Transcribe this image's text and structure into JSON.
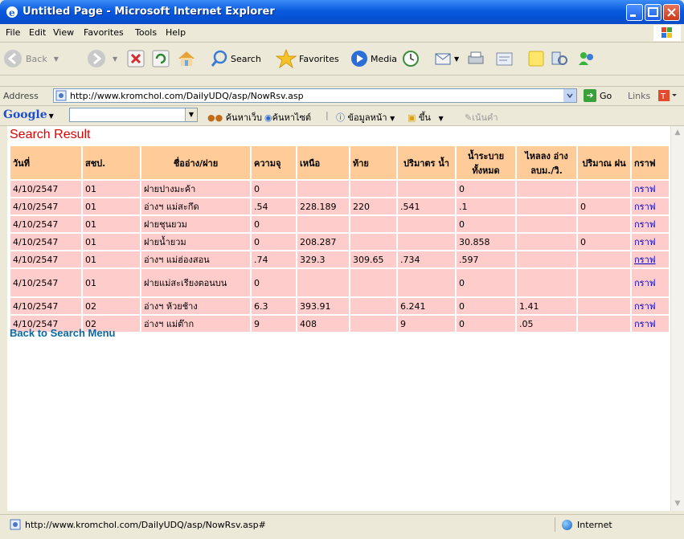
{
  "window": {
    "title": "Untitled Page - Microsoft Internet Explorer"
  },
  "menu": [
    "File",
    "Edit",
    "View",
    "Favorites",
    "Tools",
    "Help"
  ],
  "toolbar": {
    "back": "Back",
    "search": "Search",
    "favorites": "Favorites",
    "media": "Media"
  },
  "address": {
    "label": "Address",
    "url": "http://www.kromchol.com/DailyUDQ/asp/NowRsv.asp",
    "go": "Go",
    "links": "Links"
  },
  "google": {
    "logo": "Google",
    "search_web": "ค้นหาเว็บ",
    "search_site": "ค้นหาไซต์",
    "page_info": "ข้อมูลหน้า",
    "up": "ขึ้น",
    "highlight": "เน้นคำ"
  },
  "page": {
    "heading": "Search Result",
    "columns": [
      "วันที่",
      "สชป.",
      "ชื่ออ่าง/ฝาย",
      "ความจุ",
      "เหนือ",
      "ท้าย",
      "ปริมาตร น้ำ",
      "น้ำระบาย ทั้งหมด",
      "ไหลลง อ่าง ลบม./วิ.",
      "ปริมาณ ฝน",
      "กราฟ"
    ],
    "rows": [
      [
        "4/10/2547",
        "01",
        "ฝายปางมะค้า",
        "0",
        "",
        "",
        "",
        "0",
        "",
        "",
        "กราฟ"
      ],
      [
        "4/10/2547",
        "01",
        "อ่างฯ แม่สะกึด",
        ".54",
        "228.189",
        "220",
        ".541",
        ".1",
        "",
        "0",
        "กราฟ"
      ],
      [
        "4/10/2547",
        "01",
        "ฝายชุนยวม",
        "0",
        "",
        "",
        "",
        "0",
        "",
        "",
        "กราฟ"
      ],
      [
        "4/10/2547",
        "01",
        "ฝายน้ำยวม",
        "0",
        "208.287",
        "",
        "",
        "30.858",
        "",
        "0",
        "กราฟ"
      ],
      [
        "4/10/2547",
        "01",
        "อ่างฯ แม่ฮ่องสอน",
        ".74",
        "329.3",
        "309.65",
        ".734",
        ".597",
        "",
        "",
        "กราฟ"
      ],
      [
        "4/10/2547",
        "01",
        "ฝายแม่สะเรียงตอนบน",
        "0",
        "",
        "",
        "",
        "0",
        "",
        "",
        "กราฟ"
      ],
      [
        "4/10/2547",
        "02",
        "อ่างฯ ห้วยช้าง",
        "6.3",
        "393.91",
        "",
        "6.241",
        "0",
        "1.41",
        "",
        "กราฟ"
      ],
      [
        "4/10/2547",
        "02",
        "อ่างฯ แม่ต๊าก",
        "9",
        "408",
        "",
        "9",
        "0",
        ".05",
        "",
        "กราฟ"
      ]
    ],
    "back_link": "Back to Search Menu"
  },
  "status": {
    "text": "http://www.kromchol.com/DailyUDQ/asp/NowRsv.asp#",
    "zone": "Internet"
  }
}
